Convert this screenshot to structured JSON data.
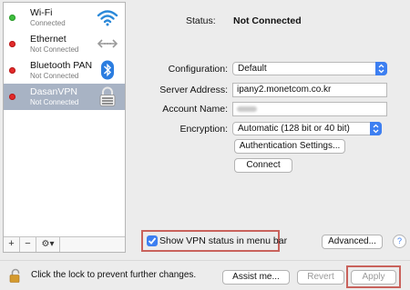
{
  "sidebar": {
    "services": [
      {
        "name": "Wi-Fi",
        "status": "Connected",
        "status_color": "#3fbf3f",
        "icon": "wifi-icon"
      },
      {
        "name": "Ethernet",
        "status": "Not Connected",
        "status_color": "#e32a2a",
        "icon": "ethernet-icon"
      },
      {
        "name": "Bluetooth PAN",
        "status": "Not Connected",
        "status_color": "#e32a2a",
        "icon": "bluetooth-icon"
      },
      {
        "name": "DasanVPN",
        "status": "Not Connected",
        "status_color": "#e32a2a",
        "icon": "vpn-lock-icon",
        "selected": true
      }
    ],
    "toolbar": {
      "add_label": "+",
      "remove_label": "−",
      "gear_label": "⚙▾"
    }
  },
  "main": {
    "status_label": "Status:",
    "status_value": "Not Connected",
    "configuration_label": "Configuration:",
    "configuration_value": "Default",
    "server_address_label": "Server Address:",
    "server_address_value": "ipany2.monetcom.co.kr",
    "account_name_label": "Account Name:",
    "encryption_label": "Encryption:",
    "encryption_value": "Automatic (128 bit or 40 bit)",
    "auth_settings_label": "Authentication Settings...",
    "connect_label": "Connect",
    "show_vpn_label": "Show VPN status in menu bar",
    "show_vpn_checked": true,
    "advanced_label": "Advanced...",
    "help_label": "?"
  },
  "footer": {
    "lock_text": "Click the lock to prevent further changes.",
    "assist_label": "Assist me...",
    "revert_label": "Revert",
    "apply_label": "Apply"
  },
  "colors": {
    "accent": "#3d7ff1",
    "highlight_box": "#c9625c",
    "selected_row": "#a8b3c4"
  }
}
